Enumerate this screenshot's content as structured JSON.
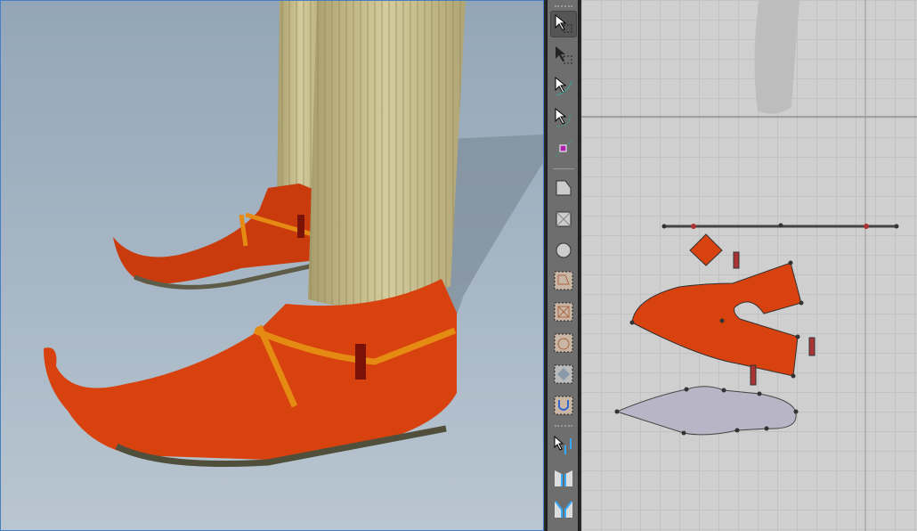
{
  "window": {
    "panels": [
      "3d-view",
      "toolbar",
      "2d-pattern-view"
    ]
  },
  "toolbar": {
    "tools": [
      "select-move",
      "transform-pattern",
      "edit-segment",
      "edit-curve",
      "add-curve-point",
      "polygon",
      "rectangle",
      "circle",
      "internal-polygon",
      "internal-rectangle",
      "internal-circle",
      "internal-diamond",
      "dart",
      "segment-sewing",
      "free-sewing",
      "fold-sewing"
    ]
  },
  "colors": {
    "shoe": "#d8420e",
    "strap": "#e58a12",
    "sock": "#c9bf8c",
    "pattern_sole": "#b8b6c6",
    "grid_bg": "#cfcfcf"
  }
}
